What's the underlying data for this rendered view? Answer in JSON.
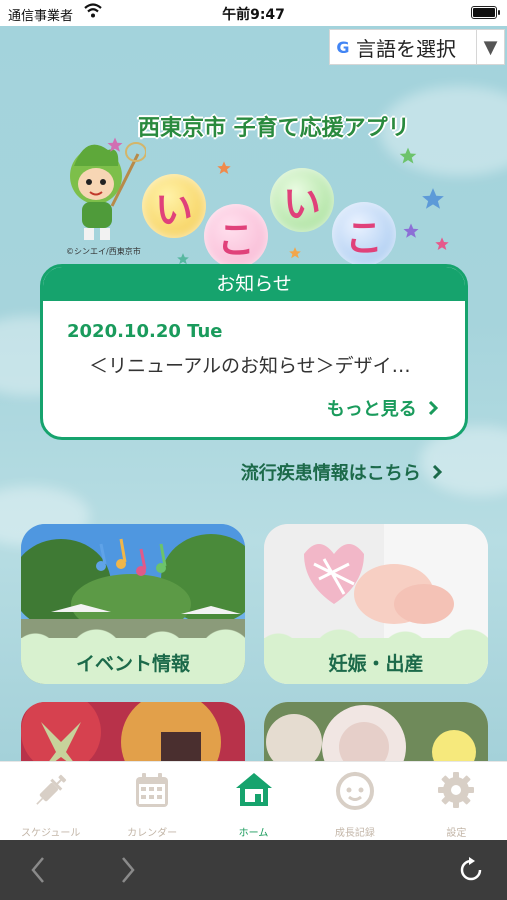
{
  "status_bar": {
    "carrier": "通信事業者",
    "time": "午前9:47"
  },
  "language": {
    "g_label": "G",
    "label": "言語を選択",
    "arrow": "▼"
  },
  "logo": {
    "subtitle": "西東京市 子育て応援アプリ",
    "chars": [
      "い",
      "こ",
      "い",
      "こ"
    ],
    "credit": "©シンエイ/西東京市"
  },
  "news": {
    "header": "お知らせ",
    "date": "2020.10.20 Tue",
    "text": "＜リニューアルのお知らせ＞デザイ…",
    "more": "もっと見る"
  },
  "disease_link": "流行疾患情報はこちら",
  "cards": [
    {
      "label": "イベント情報"
    },
    {
      "label": "妊娠・出産"
    }
  ],
  "tabs": [
    {
      "label": "スケジュール",
      "icon": "syringe-icon",
      "active": false
    },
    {
      "label": "カレンダー",
      "icon": "calendar-icon",
      "active": false
    },
    {
      "label": "ホーム",
      "icon": "home-icon",
      "active": true
    },
    {
      "label": "成長記録",
      "icon": "baby-face-icon",
      "active": false
    },
    {
      "label": "設定",
      "icon": "gear-icon",
      "active": false
    }
  ],
  "colors": {
    "accent": "#16a36d",
    "card_label_bg": "#d8f1cf",
    "tab_inactive": "#c3b6a8",
    "bg": "#a9d3dc"
  }
}
